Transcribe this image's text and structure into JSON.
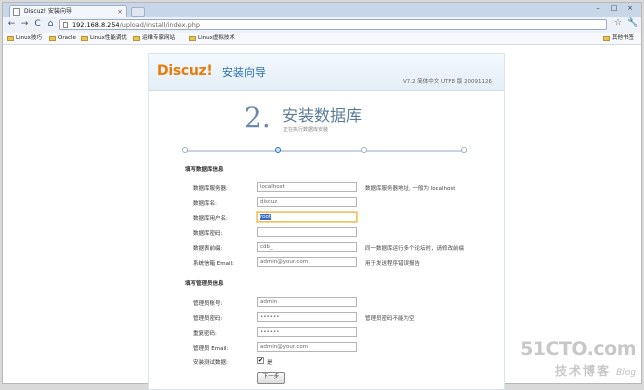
{
  "browser": {
    "tab_title": "Discuz! 安装向导",
    "tab_close": "×",
    "url_host": "192.168.8.254",
    "url_path": "/upload/install/index.php",
    "back": "←",
    "forward": "→",
    "reload": "C",
    "home": "⌂",
    "star": "☆",
    "wrench": "🔧",
    "window_controls": [
      "–",
      "□",
      "×"
    ],
    "bookmarks": [
      "Linux技巧",
      "Oracle",
      "Linux性能调优",
      "运维专家网站",
      "Linux虚拟技术"
    ],
    "other_bookmarks": "其他书签"
  },
  "installer": {
    "logo": "Discuz!",
    "wizard_title": "安装向导",
    "version": "V7.2 简体中文 UTF8 版 20091126",
    "step_number": "2.",
    "step_title": "安装数据库",
    "step_subtitle": "正在执行数据库安装",
    "progress": {
      "steps": 4,
      "current": 2
    },
    "db_section": "填写数据库信息",
    "db_fields": [
      {
        "label": "数据库服务器:",
        "value": "localhost",
        "note": "数据库服务器地址, 一般为 localhost"
      },
      {
        "label": "数据库名:",
        "value": "discuz",
        "note": ""
      },
      {
        "label": "数据库用户名:",
        "value": "root",
        "note": ""
      },
      {
        "label": "数据库密码:",
        "value": "",
        "note": ""
      },
      {
        "label": "数据表前缀:",
        "value": "cdb_",
        "note": "同一数据库运行多个论坛时，请修改前缀"
      },
      {
        "label": "系统信箱 Email:",
        "value": "admin@your.com",
        "note": "用于发送程序错误报告"
      }
    ],
    "admin_section": "填写管理员信息",
    "admin_fields": [
      {
        "label": "管理员账号:",
        "value": "admin",
        "note": ""
      },
      {
        "label": "管理员密码:",
        "value": "••••••",
        "note": "管理员密码不能为空"
      },
      {
        "label": "重复密码:",
        "value": "••••••",
        "note": ""
      },
      {
        "label": "管理员 Email:",
        "value": "admin@your.com",
        "note": ""
      }
    ],
    "testdata_label": "安装测试数据:",
    "testdata_check": "✔",
    "testdata_yes": "是",
    "next_button": "下一步"
  },
  "watermark": {
    "site": "51CTO.com",
    "tagline": "技术博客",
    "blog": "Blog"
  }
}
